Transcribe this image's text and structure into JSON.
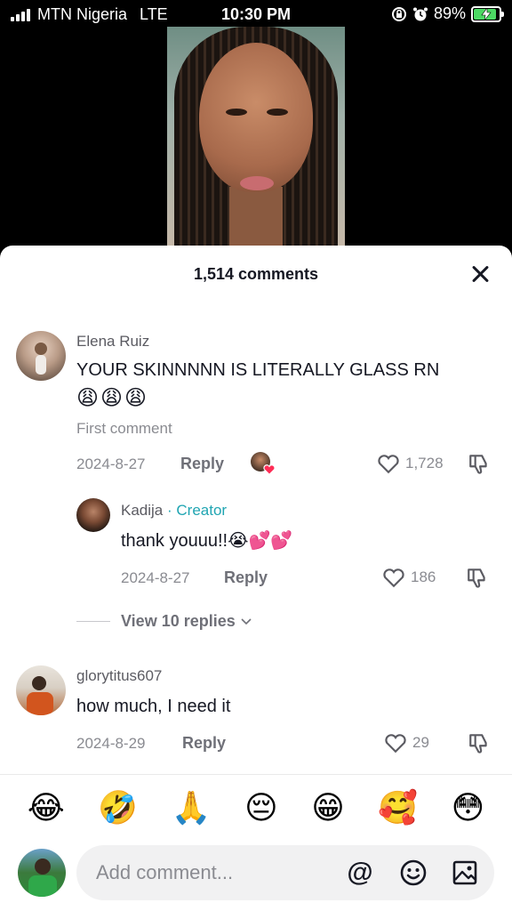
{
  "status_bar": {
    "carrier": "MTN Nigeria",
    "network": "LTE",
    "time": "10:30 PM",
    "battery": "89%",
    "battery_level": 0.89
  },
  "sheet": {
    "title": "1,514 comments"
  },
  "comments": [
    {
      "username": "Elena Ruiz",
      "text": "YOUR SKINNNNN IS LITERALLY GLASS RN",
      "emojis": "😩😩😩",
      "label": "First comment",
      "date": "2024-8-27",
      "reply_label": "Reply",
      "likes": "1,728"
    },
    {
      "username": "Kadija",
      "creator_tag": "· Creator",
      "text": "thank youuu!!😭💕💕",
      "date": "2024-8-27",
      "reply_label": "Reply",
      "likes": "186"
    },
    {
      "username": "glorytitus607",
      "text": "how much, I need it",
      "date": "2024-8-29",
      "reply_label": "Reply",
      "likes": "29"
    }
  ],
  "view_replies": "View 10 replies",
  "emoji_bar": [
    "😂",
    "🤣",
    "🙏",
    "😔",
    "😁",
    "🥰",
    "😳"
  ],
  "input": {
    "placeholder": "Add comment..."
  },
  "colors": {
    "creator": "#20a5b2",
    "heart_badge": "#fe2c55",
    "battery_fill": "#4cd964"
  },
  "icons": [
    "signal-icon",
    "alarm-icon",
    "lock-rotation-icon",
    "battery-icon",
    "close-icon",
    "heart-icon",
    "dislike-icon",
    "mention-icon",
    "emoji-icon",
    "image-icon",
    "chevron-down-icon"
  ]
}
